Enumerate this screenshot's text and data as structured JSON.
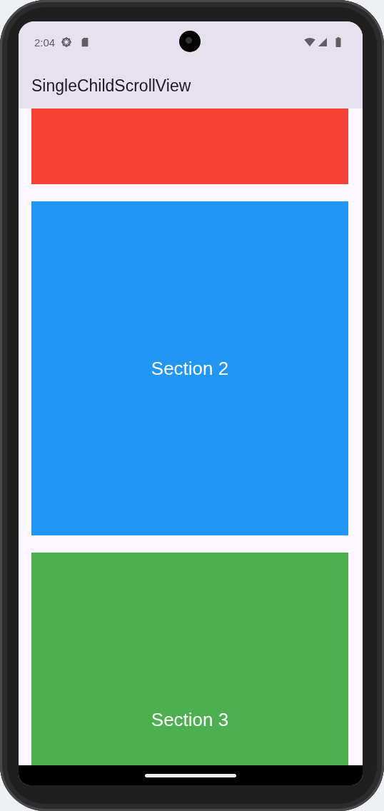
{
  "status_bar": {
    "time": "2:04"
  },
  "app_bar": {
    "title": "SingleChildScrollView"
  },
  "sections": [
    {
      "color": "#f44336"
    },
    {
      "label": "Section 2",
      "color": "#2196f3"
    },
    {
      "label": "Section 3",
      "color": "#4caf50"
    }
  ]
}
